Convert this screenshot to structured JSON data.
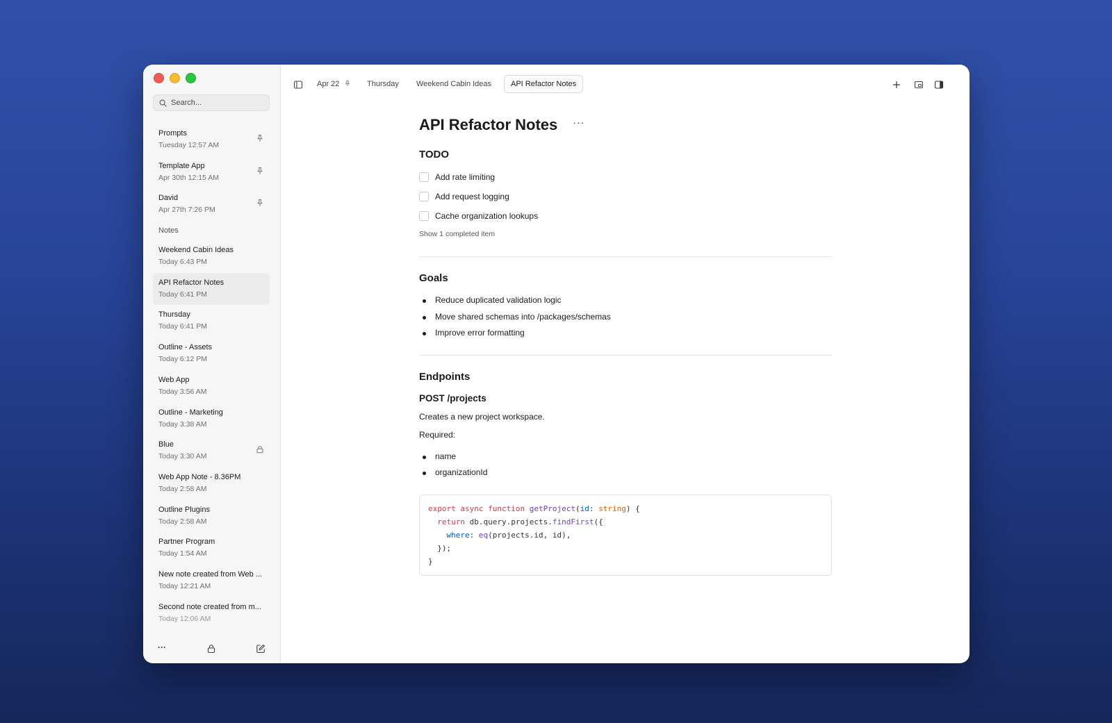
{
  "sidebar": {
    "search_placeholder": "Search...",
    "pinned": [
      {
        "title": "Prompts",
        "date": "Tuesday 12:57 AM",
        "icon": "pin-icon"
      },
      {
        "title": "Template App",
        "date": "Apr 30th 12:15 AM",
        "icon": "pin-icon"
      },
      {
        "title": "David",
        "date": "Apr 27th 7:26 PM",
        "icon": "pin-icon"
      }
    ],
    "notes_label": "Notes",
    "notes": [
      {
        "title": "Weekend Cabin Ideas",
        "date": "Today 6:43 PM"
      },
      {
        "title": "API Refactor Notes",
        "date": "Today 6:41 PM",
        "active": true
      },
      {
        "title": "Thursday",
        "date": "Today 6:41 PM"
      },
      {
        "title": "Outline - Assets",
        "date": "Today 6:12 PM"
      },
      {
        "title": "Web App",
        "date": "Today 3:56 AM"
      },
      {
        "title": "Outline - Marketing",
        "date": "Today 3:38 AM"
      },
      {
        "title": "Blue",
        "date": "Today 3:30 AM",
        "icon": "lock-icon"
      },
      {
        "title": "Web App Note - 8.36PM",
        "date": "Today 2:58 AM"
      },
      {
        "title": "Outline Plugins",
        "date": "Today 2:58 AM"
      },
      {
        "title": "Partner Program",
        "date": "Today 1:54 AM"
      },
      {
        "title": "New note created from Web ...",
        "date": "Today 12:21 AM"
      },
      {
        "title": "Second note created from m...",
        "date": "Today 12:06 AM"
      }
    ],
    "bottom": {
      "more": "···"
    }
  },
  "tabs": [
    {
      "label": "Apr 22",
      "pinned": true
    },
    {
      "label": "Thursday"
    },
    {
      "label": "Weekend Cabin Ideas"
    },
    {
      "label": "API Refactor Notes",
      "active": true
    }
  ],
  "doc": {
    "title": "API Refactor Notes",
    "more": "···",
    "todo": {
      "heading": "TODO",
      "items": [
        "Add rate limiting",
        "Add request logging",
        "Cache organization lookups"
      ],
      "show_completed": "Show 1 completed item"
    },
    "goals": {
      "heading": "Goals",
      "items": [
        "Reduce duplicated validation logic",
        "Move shared schemas into /packages/schemas",
        "Improve error formatting"
      ]
    },
    "endpoints": {
      "heading": "Endpoints",
      "subheading": "POST /projects",
      "description": "Creates a new project workspace.",
      "required_label": "Required:",
      "required": [
        "name",
        "organizationId"
      ]
    },
    "code": {
      "kw_export": "export",
      "kw_async": "async",
      "kw_function": "function",
      "fn_name": "getProject",
      "param": "id",
      "type": "string",
      "kw_return": "return",
      "call_prefix": "db.query.projects.",
      "fn_find": "findFirst",
      "prop_where": "where",
      "fn_eq": "eq",
      "eq_args": "(projects.id, id),",
      "close1": "});",
      "close2": "}"
    }
  }
}
